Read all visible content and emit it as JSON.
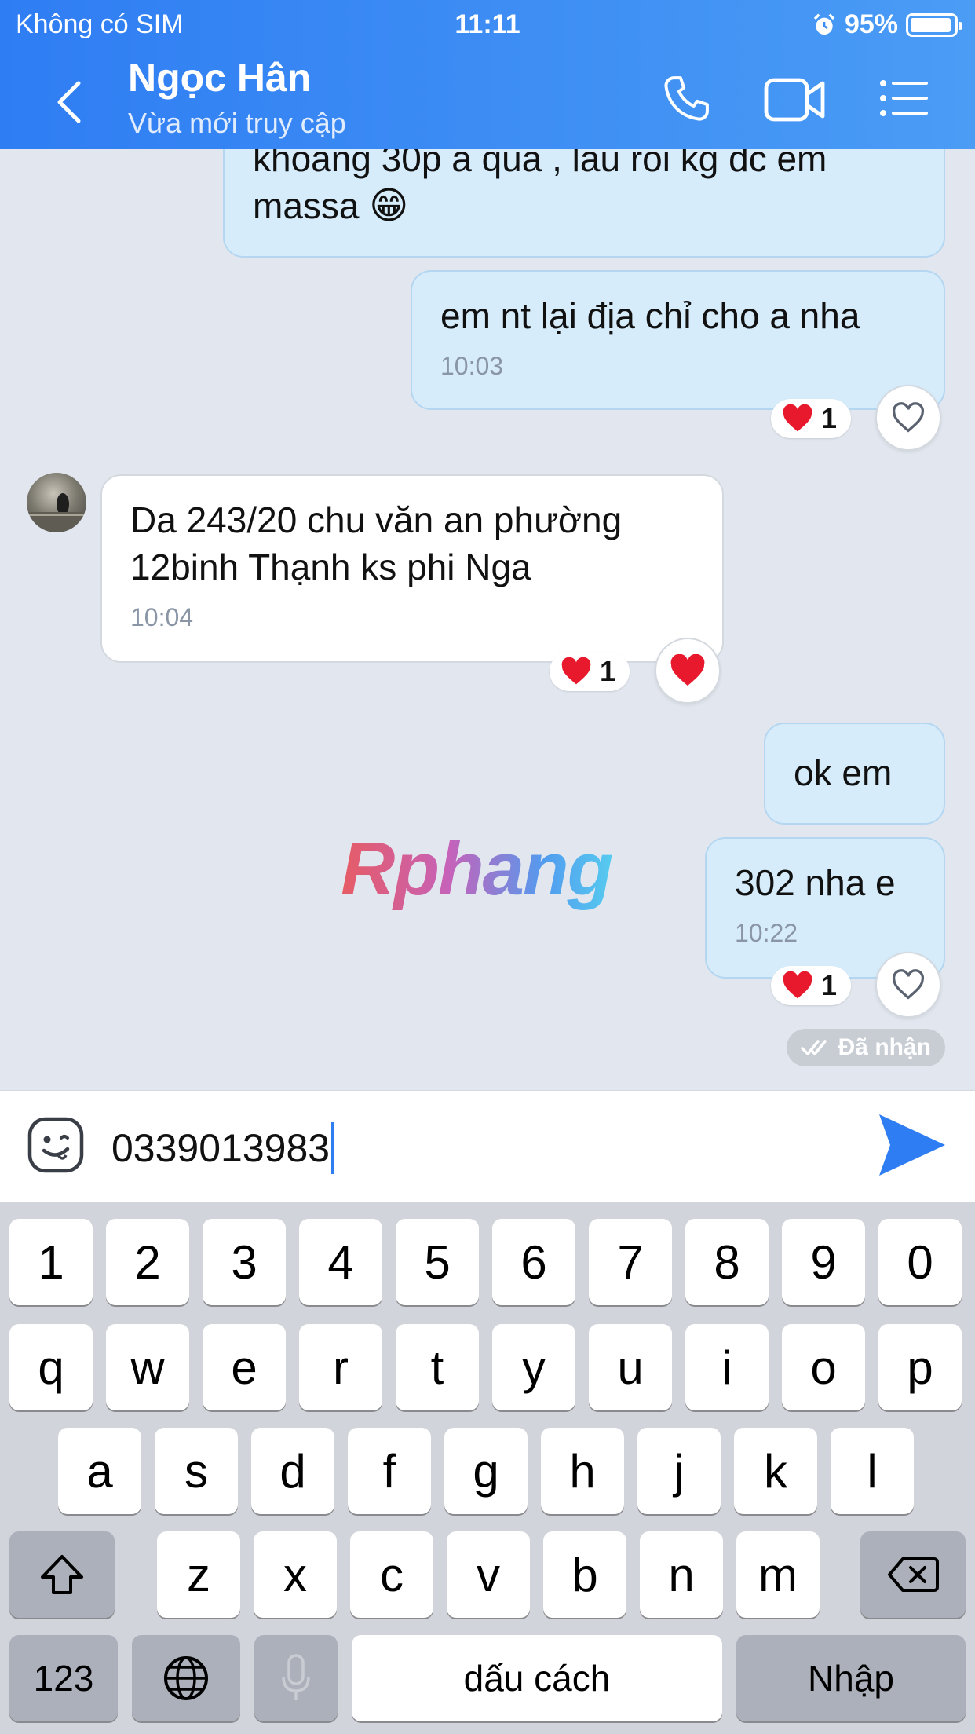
{
  "status_bar": {
    "carrier": "Không có SIM",
    "time": "11:11",
    "battery": "95%",
    "battery_level": 0.95
  },
  "header": {
    "name": "Ngọc Hân",
    "presence": "Vừa mới truy cập"
  },
  "messages": [
    {
      "text_line1": "khoang 30p a qua , lau roi kg dc em",
      "text_line2": "massa",
      "emoji": "😁"
    },
    {
      "text": "em nt lại địa chỉ cho a nha",
      "time": "10:03",
      "reaction_count": "1"
    },
    {
      "text_line1": "Da 243/20 chu văn an phường",
      "text_line2": "12binh Thạnh ks phi Nga",
      "time": "10:04",
      "reaction_count": "1"
    },
    {
      "text": "ok em"
    },
    {
      "text": "302 nha e",
      "time": "10:22",
      "reaction_count": "1"
    }
  ],
  "delivery_status": "Đã nhận",
  "watermark": "Rphang",
  "composer": {
    "value": "0339013983"
  },
  "keyboard": {
    "row1": [
      "1",
      "2",
      "3",
      "4",
      "5",
      "6",
      "7",
      "8",
      "9",
      "0"
    ],
    "row2": [
      "q",
      "w",
      "e",
      "r",
      "t",
      "y",
      "u",
      "i",
      "o",
      "p"
    ],
    "row3": [
      "a",
      "s",
      "d",
      "f",
      "g",
      "h",
      "j",
      "k",
      "l"
    ],
    "row4": [
      "z",
      "x",
      "c",
      "v",
      "b",
      "n",
      "m"
    ],
    "numbers_key": "123",
    "space_key": "dấu cách",
    "return_key": "Nhập"
  },
  "colors": {
    "header": "#2f7df3",
    "outgoing_bubble": "#d6ecfb",
    "accent": "#2f7df3",
    "heart": "#e8192c"
  }
}
